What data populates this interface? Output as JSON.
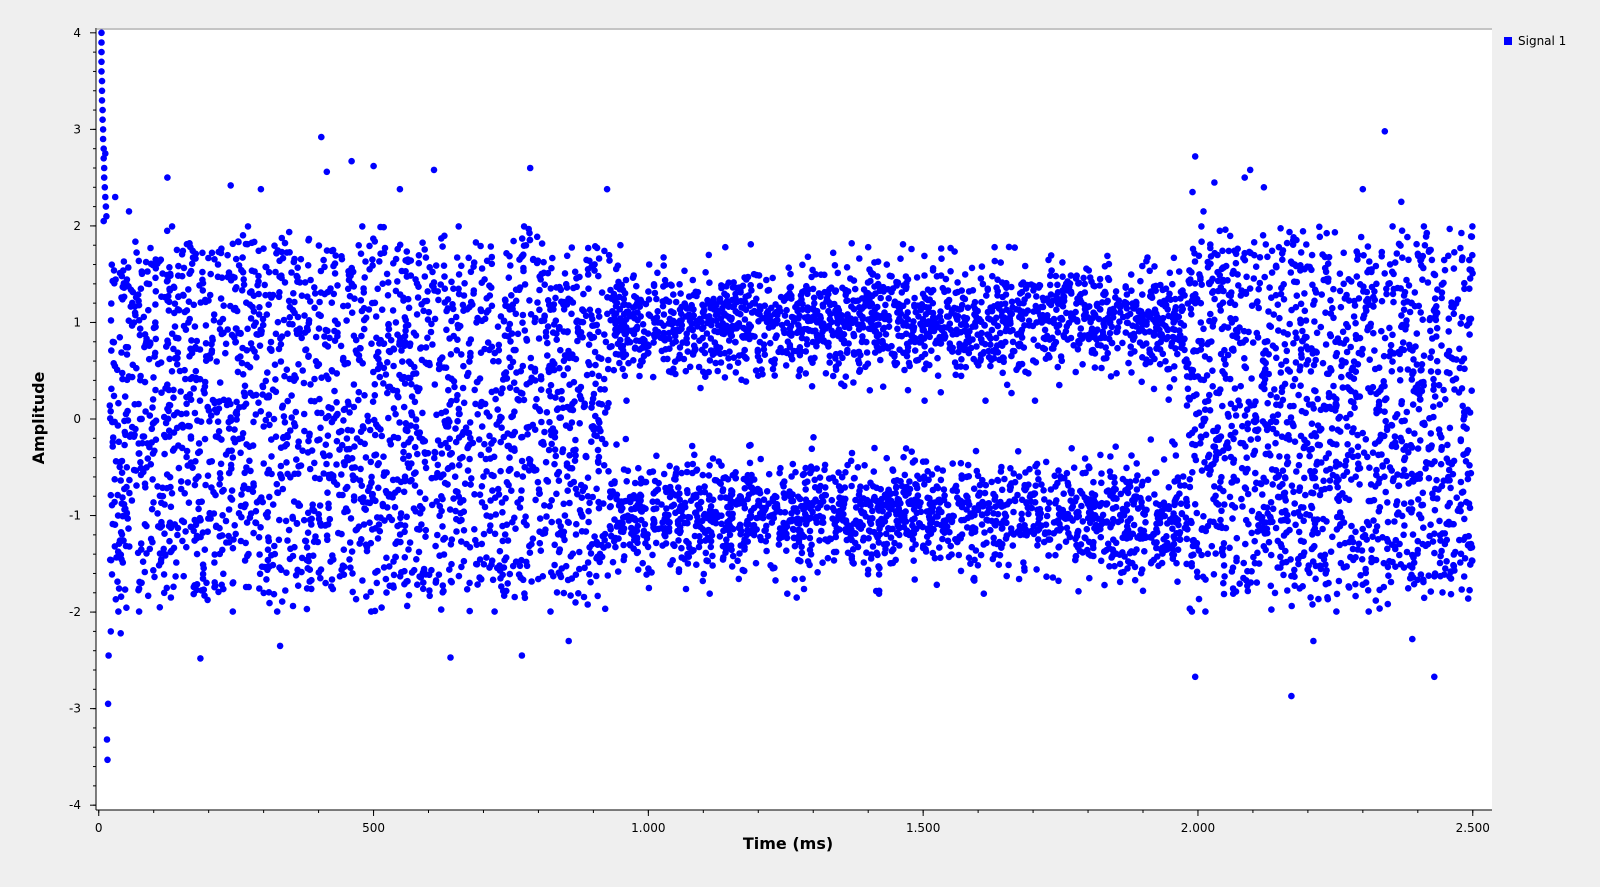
{
  "colors": {
    "window_background": "#efefef",
    "plot_background": "#ffffff",
    "series": "#0000ff",
    "axis": "#000000"
  },
  "legend": {
    "label": "Signal 1",
    "placement": "top-right"
  },
  "chart_data": {
    "type": "scatter",
    "title": "",
    "xlabel": "Time (ms)",
    "ylabel": "Amplitude",
    "xlim": [
      -5,
      2535
    ],
    "ylim": [
      -4.05,
      4.05
    ],
    "x_ticks": [
      {
        "value": 0,
        "label": "0"
      },
      {
        "value": 500,
        "label": "500"
      },
      {
        "value": 1000,
        "label": "1.000"
      },
      {
        "value": 1500,
        "label": "1.500"
      },
      {
        "value": 2000,
        "label": "2.000"
      },
      {
        "value": 2500,
        "label": "2.500"
      }
    ],
    "y_ticks": [
      {
        "value": 4,
        "label": "4"
      },
      {
        "value": 3,
        "label": "3"
      },
      {
        "value": 2,
        "label": "2"
      },
      {
        "value": 1,
        "label": "1"
      },
      {
        "value": 0,
        "label": "0"
      },
      {
        "value": -1,
        "label": "-1"
      },
      {
        "value": -2,
        "label": "-2"
      },
      {
        "value": -3,
        "label": "-3"
      },
      {
        "value": -4,
        "label": "-4"
      }
    ],
    "grid": false,
    "series": [
      {
        "name": "Signal 1",
        "color": "#0000ff",
        "points": [
          [
            5,
            4.0
          ],
          [
            5,
            3.9
          ],
          [
            5,
            3.8
          ],
          [
            5,
            3.7
          ],
          [
            5,
            3.6
          ],
          [
            6,
            3.5
          ],
          [
            6,
            3.4
          ],
          [
            6,
            3.3
          ],
          [
            7,
            3.2
          ],
          [
            7,
            3.1
          ],
          [
            8,
            3.0
          ],
          [
            8,
            2.9
          ],
          [
            9,
            2.8
          ],
          [
            9,
            2.7
          ],
          [
            10,
            2.6
          ],
          [
            10,
            2.5
          ],
          [
            11,
            2.4
          ],
          [
            12,
            2.3
          ],
          [
            13,
            2.2
          ],
          [
            14,
            2.1
          ],
          [
            12,
            2.75
          ],
          [
            9,
            2.05
          ],
          [
            17,
            -2.95
          ],
          [
            15,
            -3.32
          ],
          [
            16,
            -3.53
          ],
          [
            18,
            -2.45
          ],
          [
            22,
            -2.2
          ],
          [
            30,
            2.3
          ],
          [
            40,
            -2.22
          ],
          [
            55,
            2.15
          ],
          [
            125,
            2.5
          ],
          [
            185,
            -2.48
          ],
          [
            240,
            2.42
          ],
          [
            295,
            2.38
          ],
          [
            330,
            -2.35
          ],
          [
            405,
            2.92
          ],
          [
            415,
            2.56
          ],
          [
            460,
            2.67
          ],
          [
            500,
            2.62
          ],
          [
            548,
            2.38
          ],
          [
            610,
            2.58
          ],
          [
            640,
            -2.47
          ],
          [
            770,
            -2.45
          ],
          [
            785,
            2.6
          ],
          [
            855,
            -2.3
          ],
          [
            925,
            2.38
          ],
          [
            1000,
            -1.55
          ],
          [
            1110,
            1.7
          ],
          [
            1140,
            1.78
          ],
          [
            1270,
            -1.85
          ],
          [
            1370,
            1.82
          ],
          [
            1400,
            1.78
          ],
          [
            1420,
            -1.78
          ],
          [
            1550,
            1.77
          ],
          [
            1630,
            1.78
          ],
          [
            1830,
            -1.72
          ],
          [
            1900,
            -1.78
          ],
          [
            1995,
            2.72
          ],
          [
            1995,
            -2.67
          ],
          [
            1990,
            2.35
          ],
          [
            2010,
            2.15
          ],
          [
            2030,
            2.45
          ],
          [
            2085,
            2.5
          ],
          [
            2095,
            2.58
          ],
          [
            2120,
            2.4
          ],
          [
            2170,
            -2.87
          ],
          [
            2210,
            -2.3
          ],
          [
            2300,
            2.38
          ],
          [
            2340,
            2.98
          ],
          [
            2370,
            2.25
          ],
          [
            2430,
            -2.67
          ],
          [
            2390,
            -2.28
          ]
        ],
        "generated_dense_points": {
          "description": "randomised samples filling the visible envelope",
          "segments": [
            {
              "from": 20,
              "to": 930,
              "count": 2400,
              "shape": "noise",
              "spread": 1.9
            },
            {
              "from": 930,
              "to": 1980,
              "count": 3200,
              "shape": "bimodal",
              "levels": [
                1.0,
                -1.0
              ],
              "spread": 0.45
            },
            {
              "from": 1980,
              "to": 2500,
              "count": 1500,
              "shape": "noise",
              "spread": 1.9
            }
          ]
        }
      }
    ]
  }
}
